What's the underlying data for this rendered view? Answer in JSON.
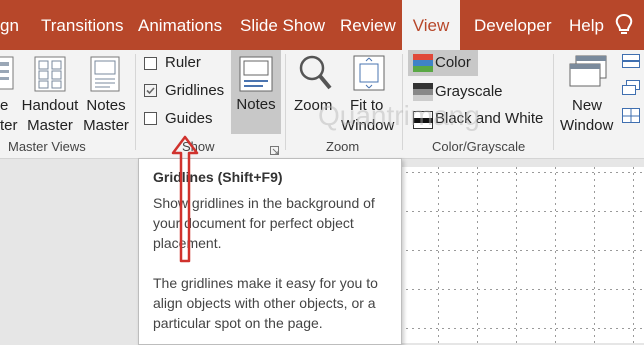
{
  "tabs": [
    "gn",
    "Transitions",
    "Animations",
    "Slide Show",
    "Review",
    "View",
    "Developer",
    "Help"
  ],
  "master_views": {
    "cut_label_1": "e",
    "cut_label_2": "ter",
    "handout_1": "Handout",
    "handout_2": "Master",
    "notes_1": "Notes",
    "notes_2": "Master",
    "group": "Master Views"
  },
  "show": {
    "ruler": "Ruler",
    "gridlines": "Gridlines",
    "guides": "Guides",
    "group": "Show",
    "ruler_checked": false,
    "gridlines_checked": true,
    "guides_checked": false
  },
  "notes": {
    "label": "Notes"
  },
  "zoom": {
    "zoom": "Zoom",
    "fit_1": "Fit to",
    "fit_2": "Window",
    "group": "Zoom"
  },
  "color": {
    "color": "Color",
    "grayscale": "Grayscale",
    "bw": "Black and White",
    "group": "Color/Grayscale"
  },
  "window": {
    "new_1": "New",
    "new_2": "Window"
  },
  "tooltip": {
    "title": "Gridlines (Shift+F9)",
    "p1": "Show gridlines in the background of your document for perfect object placement.",
    "p2": "The gridlines make it easy for you to align objects with other objects, or a particular spot on the page."
  },
  "watermark": "Quantrimang",
  "colors": {
    "accent": "#b7472a",
    "arrow": "#d0322d",
    "ribbon": "#f3f3f3"
  }
}
